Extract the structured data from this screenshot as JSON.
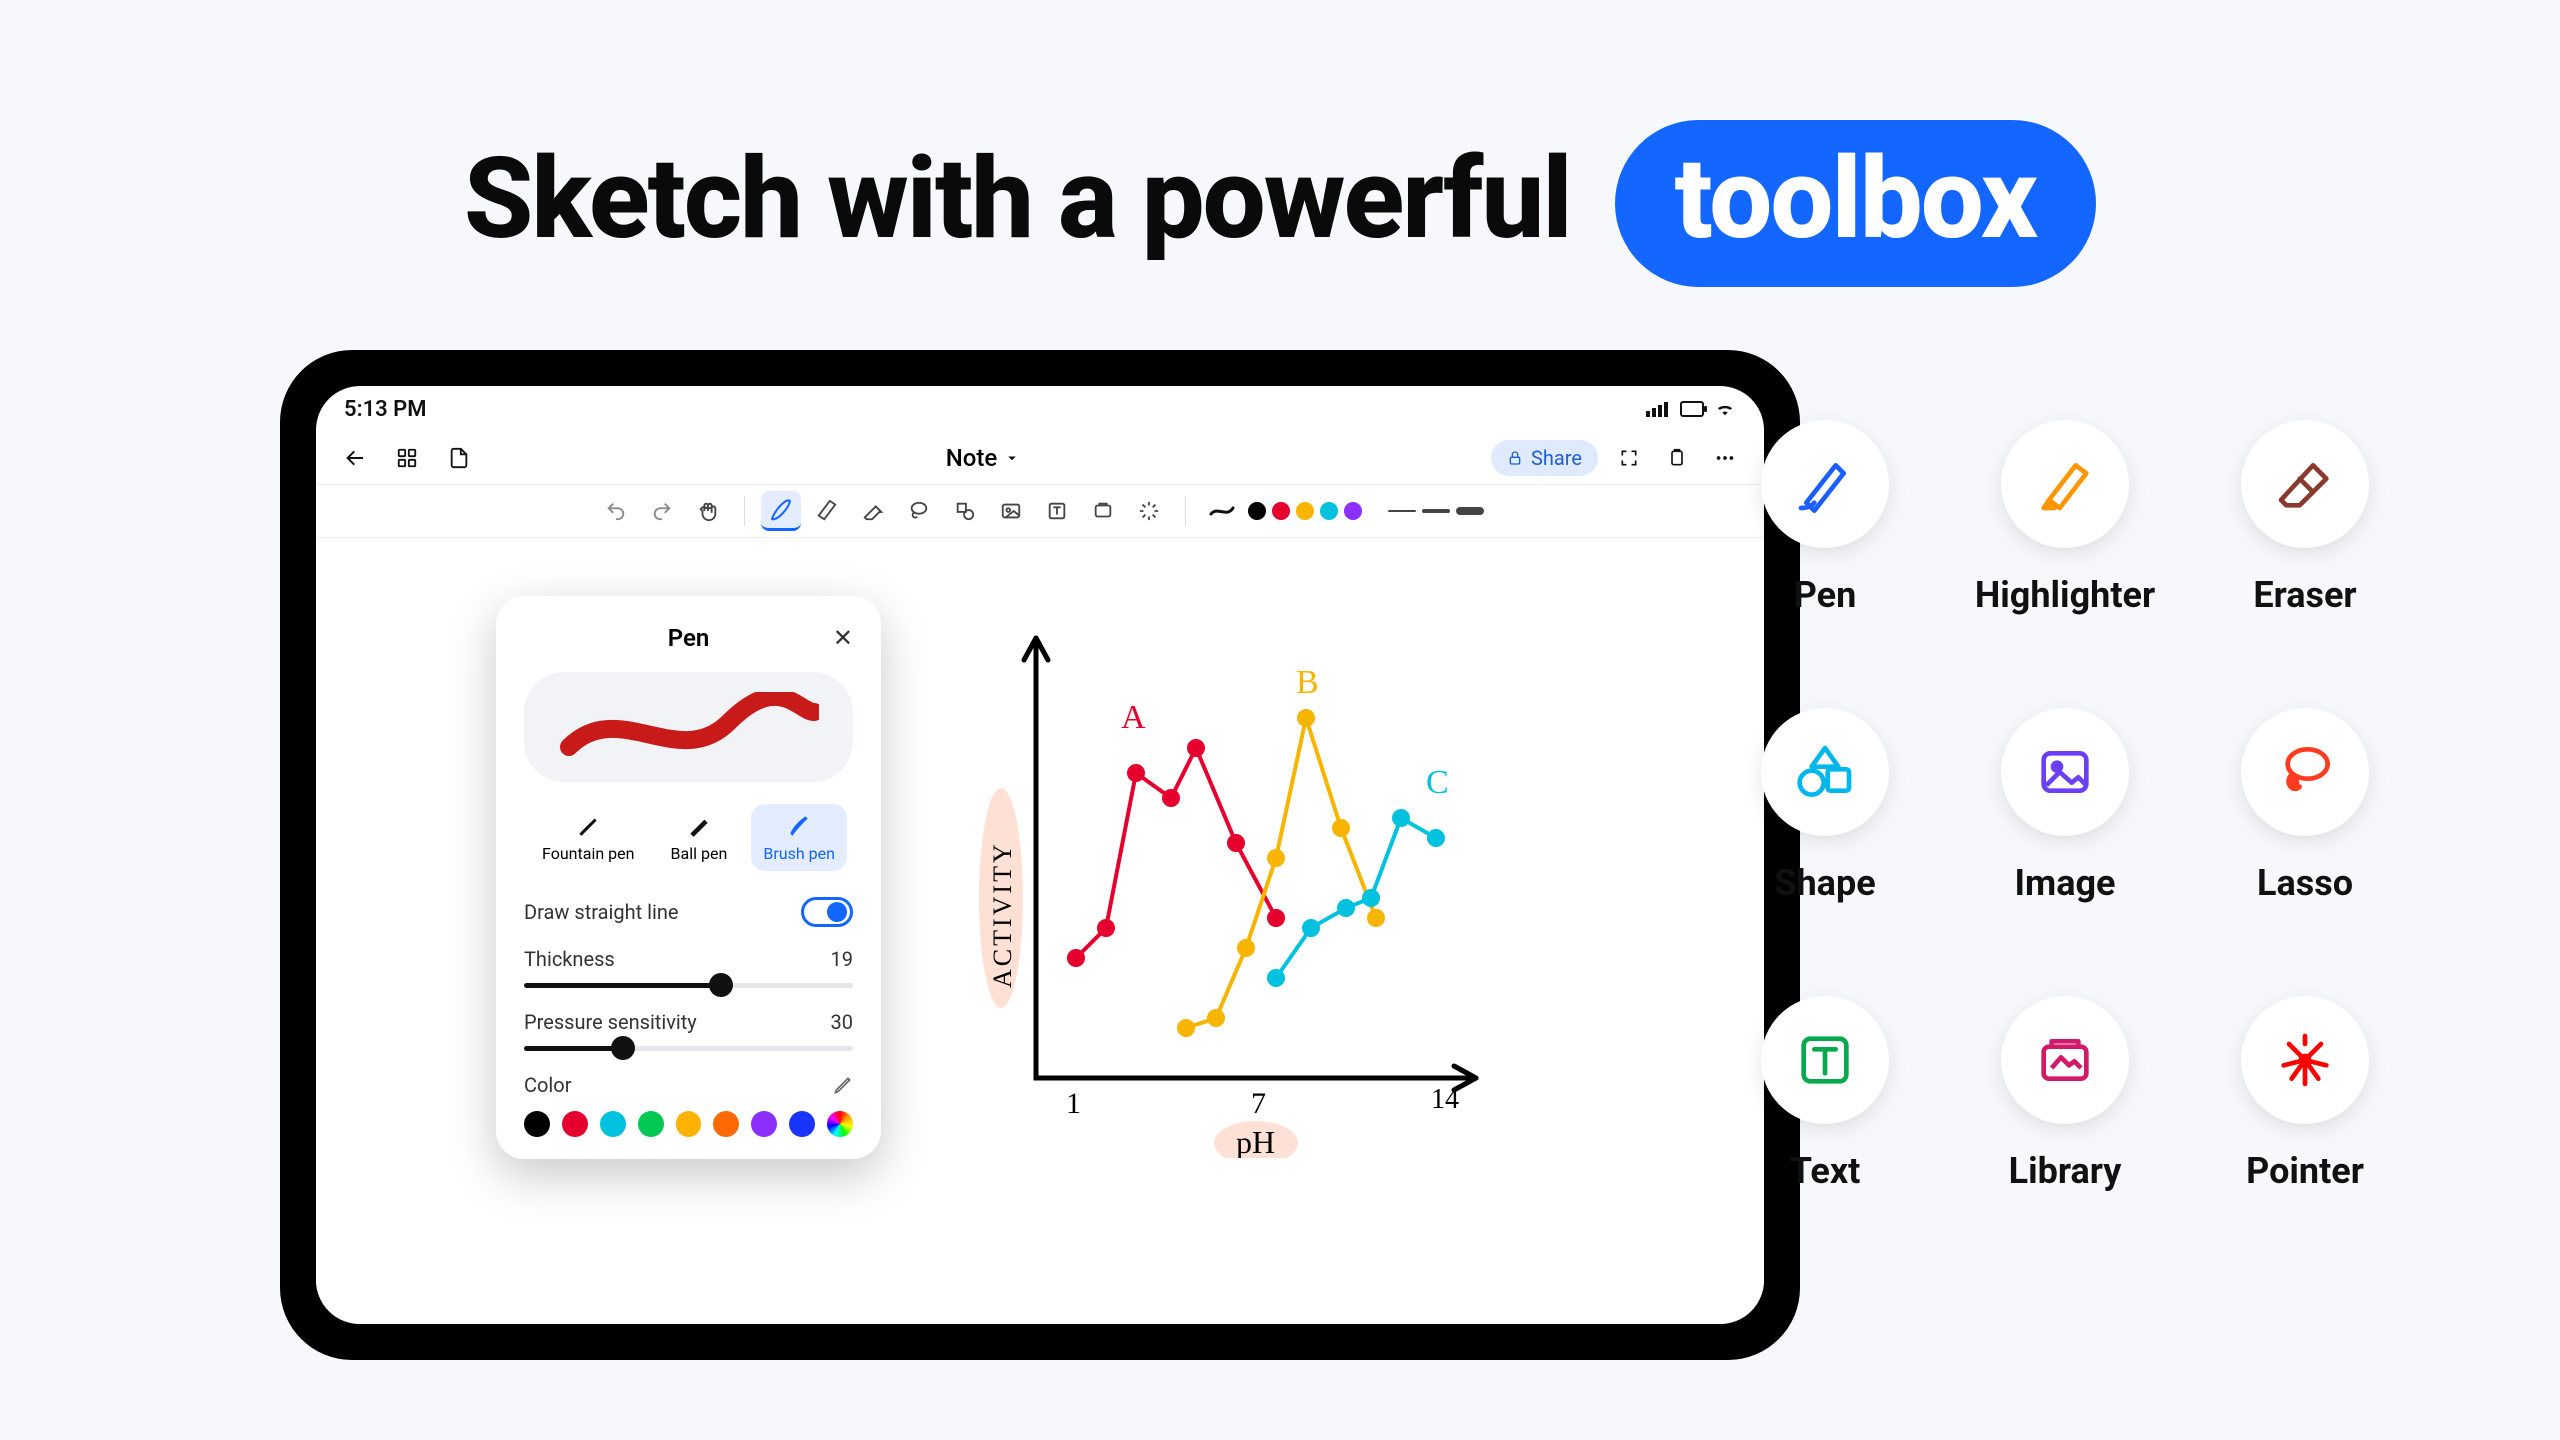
{
  "headline": {
    "main": "Sketch with a powerful",
    "pill": "toolbox"
  },
  "status_bar": {
    "time": "5:13 PM"
  },
  "app_header": {
    "title": "Note",
    "share_label": "Share"
  },
  "toolbar": {
    "colors": [
      "#000000",
      "#e6002d",
      "#f7b500",
      "#00c1de",
      "#8c30ff"
    ]
  },
  "pen_popup": {
    "title": "Pen",
    "types": {
      "fountain": "Fountain pen",
      "ball": "Ball pen",
      "brush": "Brush pen"
    },
    "active_type": "brush",
    "draw_straight_label": "Draw straight line",
    "draw_straight_on": true,
    "thickness_label": "Thickness",
    "thickness_value": "19",
    "thickness_pct": 60,
    "pressure_label": "Pressure sensitivity",
    "pressure_value": "30",
    "pressure_pct": 30,
    "color_label": "Color",
    "swatches": [
      "#000000",
      "#e6002d",
      "#00c1de",
      "#00c853",
      "#ffb300",
      "#ff6a00",
      "#8c30ff",
      "#1a34ff"
    ]
  },
  "tools_grid": [
    {
      "key": "pen",
      "label": "Pen",
      "color": "#1a5eff"
    },
    {
      "key": "highlighter",
      "label": "Highlighter",
      "color": "#ff9500"
    },
    {
      "key": "eraser",
      "label": "Eraser",
      "color": "#8a3a2d"
    },
    {
      "key": "shape",
      "label": "Shape",
      "color": "#00b7eb"
    },
    {
      "key": "image",
      "label": "Image",
      "color": "#6b3ff5"
    },
    {
      "key": "lasso",
      "label": "Lasso",
      "color": "#ff3b1f"
    },
    {
      "key": "text",
      "label": "Text",
      "color": "#06a94d"
    },
    {
      "key": "library",
      "label": "Library",
      "color": "#d21a6b"
    },
    {
      "key": "pointer",
      "label": "Pointer",
      "color": "#ff0000"
    }
  ],
  "chart_data": {
    "type": "line",
    "title": "",
    "xlabel": "pH",
    "ylabel": "ACTIVITY",
    "xlim": [
      1,
      14
    ],
    "ylim": [
      0,
      10
    ],
    "x_ticks": [
      1,
      7,
      14
    ],
    "series": [
      {
        "name": "A",
        "color": "#e6002d",
        "x": [
          2,
          3,
          4,
          5,
          6,
          7,
          8
        ],
        "y": [
          3.0,
          3.5,
          7.5,
          6.8,
          8.2,
          6.0,
          4.2
        ]
      },
      {
        "name": "B",
        "color": "#f7b500",
        "x": [
          5,
          6,
          7,
          8,
          9,
          10,
          11
        ],
        "y": [
          1.8,
          2.0,
          3.8,
          6.0,
          8.8,
          6.4,
          4.3
        ]
      },
      {
        "name": "C",
        "color": "#00c1de",
        "x": [
          8,
          9,
          10,
          11,
          12
        ],
        "y": [
          3.0,
          4.4,
          4.8,
          6.8,
          6.3
        ]
      }
    ],
    "annotations": [
      {
        "text": "A",
        "x": 3.5,
        "y": 9.0,
        "color": "#e6002d"
      },
      {
        "text": "B",
        "x": 8.5,
        "y": 9.8,
        "color": "#f7b500"
      },
      {
        "text": "C",
        "x": 12.2,
        "y": 7.4,
        "color": "#00c1de"
      }
    ]
  }
}
